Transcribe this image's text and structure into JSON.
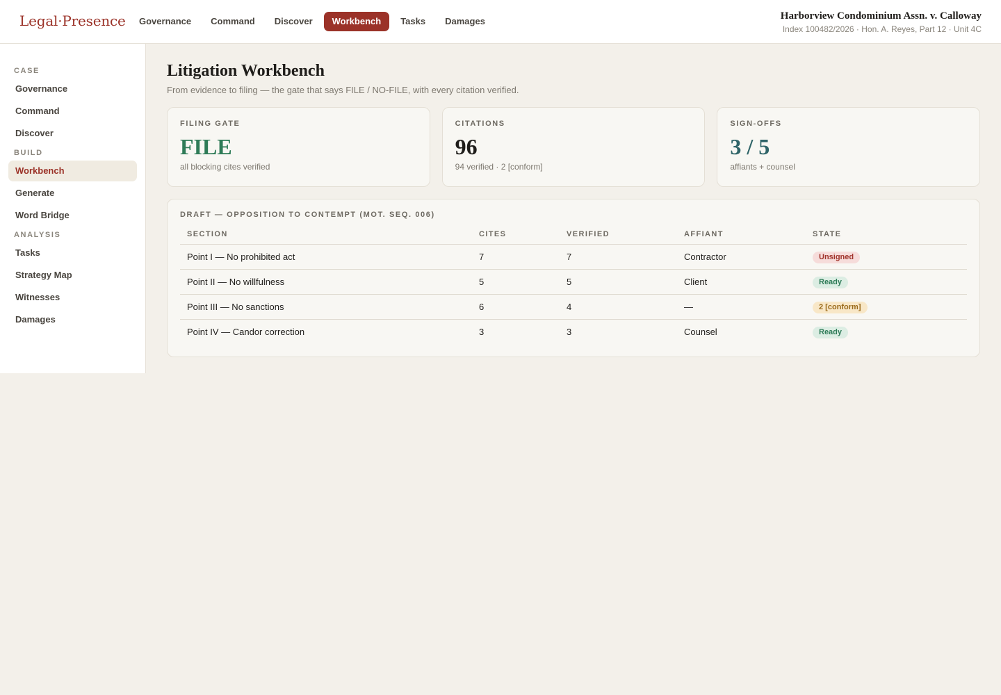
{
  "brand": {
    "left": "Legal",
    "dot": "·",
    "right": "Presence"
  },
  "topnav": [
    "Governance",
    "Command",
    "Discover",
    "Workbench",
    "Tasks",
    "Damages"
  ],
  "topnav_active": "Workbench",
  "case": {
    "title": "Harborview Condominium Assn. v. Calloway",
    "subtitle": "Index 100482/2026 · Hon. A. Reyes, Part 12 · Unit 4C"
  },
  "sidebar": {
    "sections": [
      {
        "label": "CASE",
        "items": [
          "Governance",
          "Command",
          "Discover"
        ]
      },
      {
        "label": "BUILD",
        "items": [
          "Workbench",
          "Generate",
          "Word Bridge"
        ]
      },
      {
        "label": "ANALYSIS",
        "items": [
          "Tasks",
          "Strategy Map",
          "Witnesses",
          "Damages"
        ]
      }
    ],
    "active": "Workbench"
  },
  "page": {
    "title": "Litigation Workbench",
    "subtitle": "From evidence to filing — the gate that says FILE / NO-FILE, with every citation verified."
  },
  "cards": [
    {
      "label": "FILING GATE",
      "value": "FILE",
      "note": "all blocking cites verified",
      "tone": "green"
    },
    {
      "label": "CITATIONS",
      "value": "96",
      "note": "94 verified · 2 [conform]",
      "tone": "dark"
    },
    {
      "label": "SIGN-OFFS",
      "value": "3 / 5",
      "note": "affiants + counsel",
      "tone": "teal"
    }
  ],
  "draft": {
    "title": "DRAFT — OPPOSITION TO CONTEMPT (MOT. SEQ. 006)",
    "columns": [
      "SECTION",
      "CITES",
      "VERIFIED",
      "AFFIANT",
      "STATE"
    ],
    "rows": [
      {
        "section": "Point I — No prohibited act",
        "cites": "7",
        "verified": "7",
        "affiant": "Contractor",
        "state": "Unsigned",
        "tone": "red"
      },
      {
        "section": "Point II — No willfulness",
        "cites": "5",
        "verified": "5",
        "affiant": "Client",
        "state": "Ready",
        "tone": "green"
      },
      {
        "section": "Point III — No sanctions",
        "cites": "6",
        "verified": "4",
        "affiant": "—",
        "state": "2 [conform]",
        "tone": "amber"
      },
      {
        "section": "Point IV — Candor correction",
        "cites": "3",
        "verified": "3",
        "affiant": "Counsel",
        "state": "Ready",
        "tone": "green"
      }
    ]
  },
  "colors": {
    "accent": "#9b3228",
    "green": "#2e7b57",
    "teal": "#2f6468",
    "amber": "#9a6a1a"
  }
}
